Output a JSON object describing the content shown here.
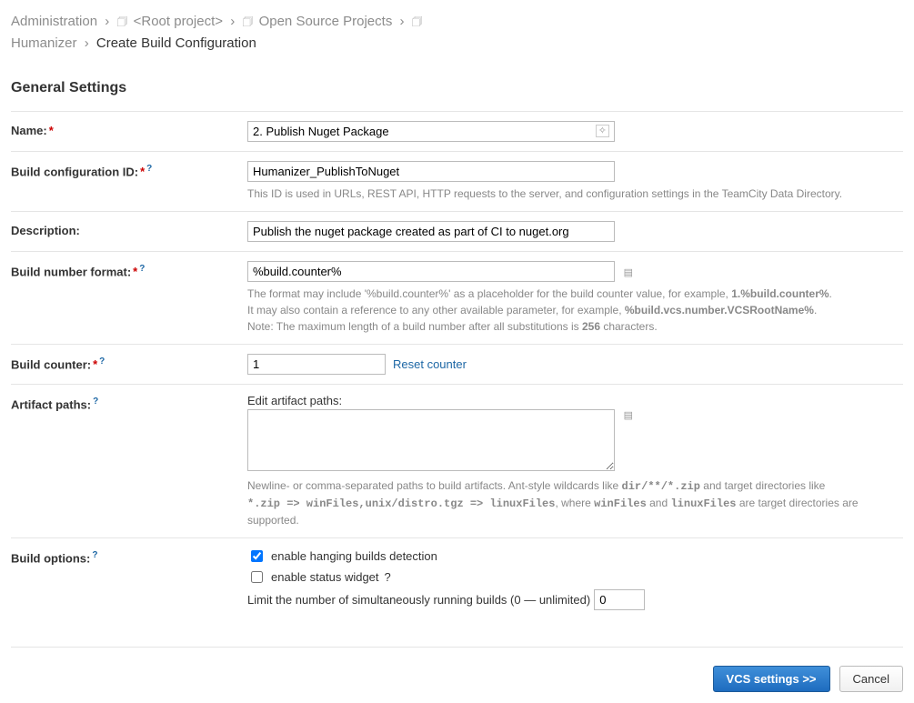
{
  "breadcrumb": {
    "admin": "Administration",
    "root": "<Root project>",
    "open_source": "Open Source Projects",
    "project": "Humanizer",
    "current": "Create Build Configuration"
  },
  "section_title": "General Settings",
  "fields": {
    "name": {
      "label": "Name:",
      "value": "2. Publish Nuget Package"
    },
    "config_id": {
      "label": "Build configuration ID:",
      "value": "Humanizer_PublishToNuget",
      "hint": "This ID is used in URLs, REST API, HTTP requests to the server, and configuration settings in the TeamCity Data Directory."
    },
    "description": {
      "label": "Description:",
      "value": "Publish the nuget package created as part of CI to nuget.org"
    },
    "build_number_format": {
      "label": "Build number format:",
      "value": "%build.counter%",
      "hint1_a": "The format may include '%build.counter%' as a placeholder for the build counter value, for example, ",
      "hint1_b": "1.%build.counter%",
      "hint1_c": ".",
      "hint2_a": "It may also contain a reference to any other available parameter, for example, ",
      "hint2_b": "%build.vcs.number.VCSRootName%",
      "hint2_c": ".",
      "hint3_a": "Note: The maximum length of a build number after all substitutions is ",
      "hint3_b": "256",
      "hint3_c": " characters."
    },
    "build_counter": {
      "label": "Build counter:",
      "value": "1",
      "reset": "Reset counter"
    },
    "artifact_paths": {
      "label": "Artifact paths:",
      "edit_label": "Edit artifact paths:",
      "value": "",
      "hint_a": "Newline- or comma-separated paths to build artifacts. Ant-style wildcards like ",
      "hint_b": "dir/**/*.zip",
      "hint_c": " and target directories like ",
      "hint_d": "*.zip => winFiles,unix/distro.tgz => linuxFiles",
      "hint_e": ", where ",
      "hint_f": "winFiles",
      "hint_g": " and ",
      "hint_h": "linuxFiles",
      "hint_i": " are target directories are supported."
    },
    "build_options": {
      "label": "Build options:",
      "hanging": "enable hanging builds detection",
      "status_widget": "enable status widget",
      "limit_label": "Limit the number of simultaneously running builds (0 — unlimited)",
      "limit_value": "0"
    }
  },
  "footer": {
    "primary": "VCS settings >>",
    "cancel": "Cancel"
  }
}
